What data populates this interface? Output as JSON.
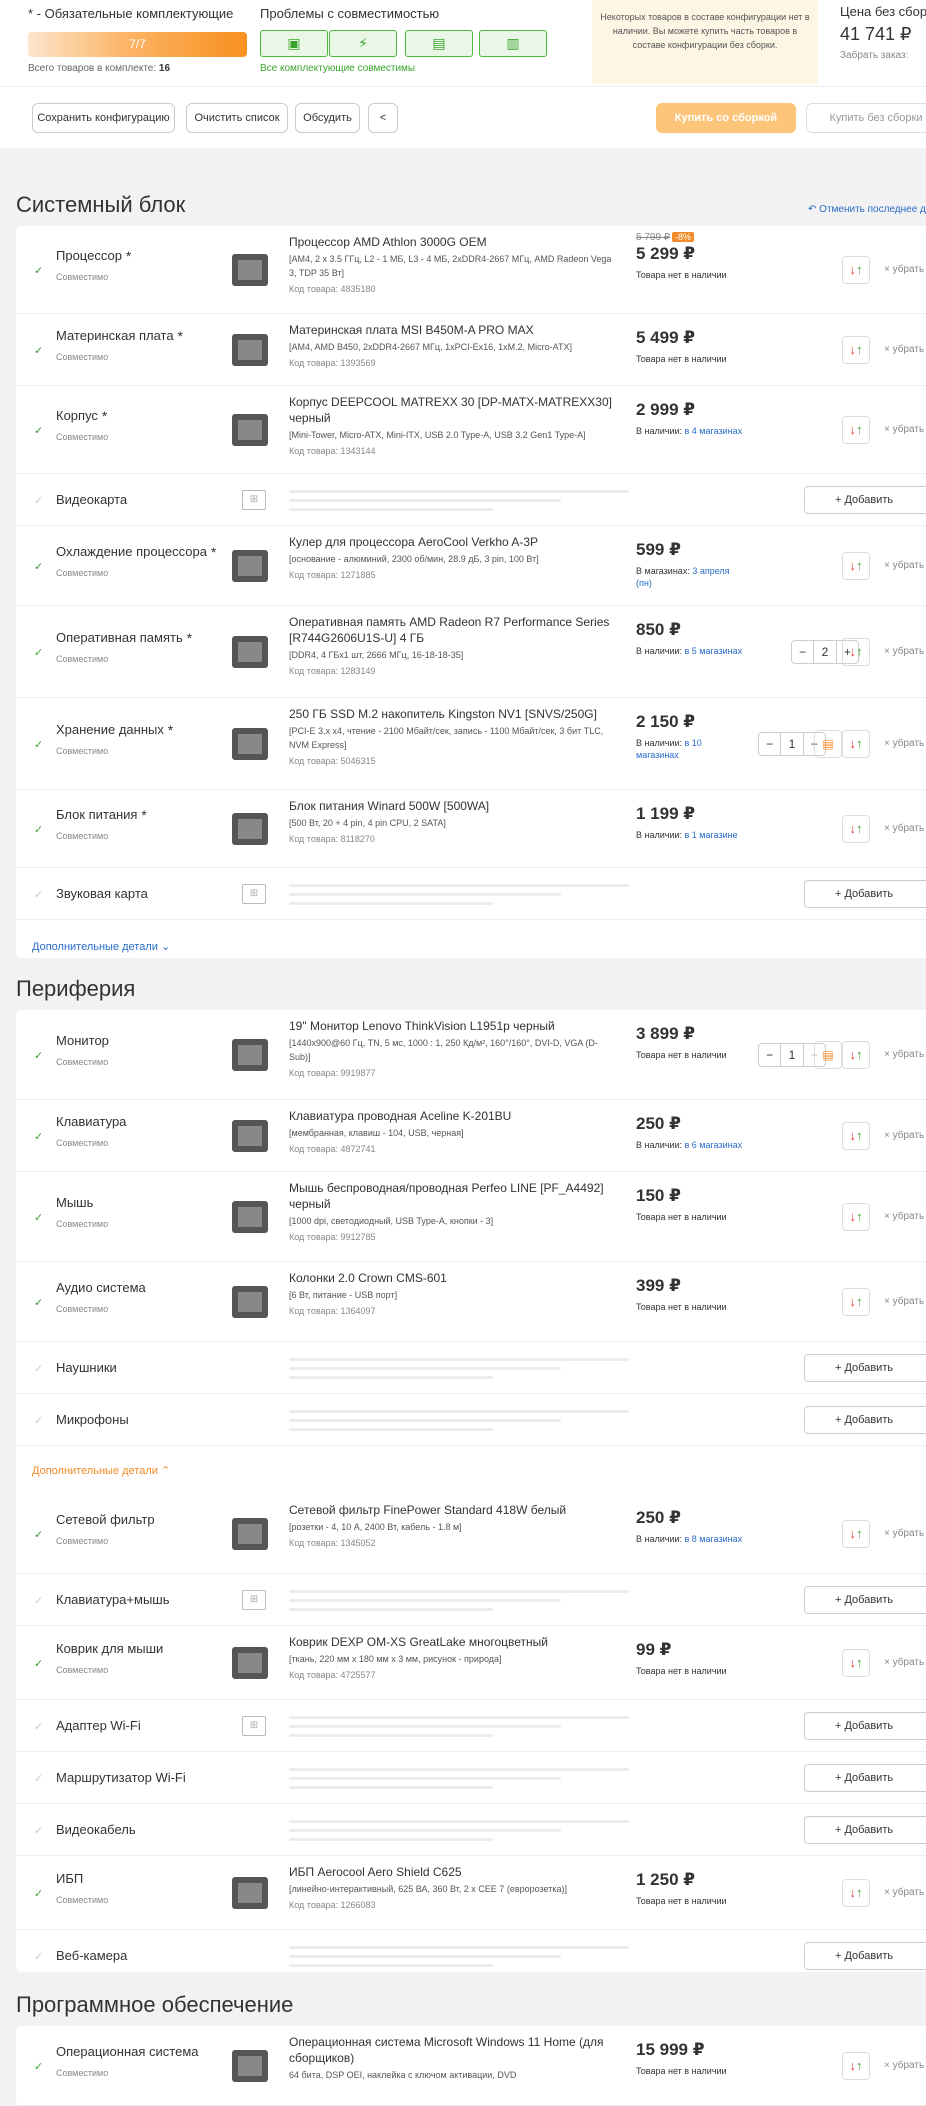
{
  "header": {
    "required_label": "* - Обязательные комплектующие",
    "progress_text": "7/7",
    "progress": 1.0,
    "total_label": "Всего товаров в комплекте:",
    "total_value": "16",
    "compat_title": "Проблемы с совместимостью",
    "compat_ok": "Все комплектующие совместимы",
    "notice": "Некоторых товаров в составе конфигурации нет в наличии. Вы можете купить часть товаров в составе конфигурации без сборки.",
    "price_no_build_label": "Цена без сборки",
    "price_no_build": "41 741 ₽",
    "pickup": "Забрать заказ:"
  },
  "actions": {
    "save": "Сохранить конфигурацию",
    "clear": "Очистить список",
    "discuss": "Обсудить",
    "share_icon": "share-icon",
    "buy_with_build": "Купить со сборкой",
    "buy_without_build": "Купить без сборки"
  },
  "sections": {
    "system_title": "Системный блок",
    "cancel_last": "Отменить последнее действие",
    "peripherals_title": "Периферия",
    "software_title": "Программное обеспечение"
  },
  "common": {
    "compatible": "Совместимо",
    "remove": "убрать",
    "add": "+ Добавить",
    "more_details": "Дополнительные детали",
    "code_prefix": "Код товара:"
  },
  "system_rows": [
    {
      "category": "Процессор",
      "required": true,
      "title": "Процессор AMD Athlon 3000G OEM",
      "spec": "[AM4, 2 x 3.5 ГГц, L2 - 1 МБ, L3 - 4 МБ, 2xDDR4-2667 МГц, AMD Radeon Vega 3, TDP 35 Вт]",
      "code": "Код товара: 4835180",
      "old_price": "5 799 ₽",
      "discount": "-8%",
      "price": "5 299 ₽",
      "stock": "Товара нет в наличии",
      "stock_link": ""
    },
    {
      "category": "Материнская плата",
      "required": true,
      "title": "Материнская плата MSI B450M-A PRO MAX",
      "spec": "[AM4, AMD B450, 2xDDR4-2667 МГц, 1xPCI-Ex16, 1xM.2, Micro-ATX]",
      "code": "Код товара: 1393569",
      "price": "5 499 ₽",
      "stock": "Товара нет в наличии",
      "stock_link": ""
    },
    {
      "category": "Корпус",
      "required": true,
      "title": "Корпус DEEPCOOL MATREXX 30 [DP-MATX-MATREXX30] черный",
      "spec": "[Mini-Tower, Micro-ATX, Mini-ITX, USB 2.0 Type-A, USB 3.2 Gen1 Type-A]",
      "code": "Код товара: 1343144",
      "price": "2 999 ₽",
      "stock": "В наличии:",
      "stock_link": "в 4 магазинах"
    },
    {
      "category": "Видеокарта",
      "empty": true
    },
    {
      "category": "Охлаждение процессора",
      "required": true,
      "title": "Кулер для процессора AeroCool Verkho A-3P",
      "spec": "[основание - алюминий, 2300 об/мин, 28.9 дБ, 3 pin, 100 Вт]",
      "code": "Код товара: 1271885",
      "price": "599 ₽",
      "stock": "В магазинах:",
      "stock_link": "3 апреля (пн)"
    },
    {
      "category": "Оперативная память",
      "required": true,
      "title": "Оперативная память AMD Radeon R7 Performance Series [R744G2606U1S-U] 4 ГБ",
      "spec": "[DDR4, 4 ГБx1 шт, 2666 МГц, 16-18-18-35]",
      "code": "Код товара: 1283149",
      "price": "850 ₽",
      "stock": "В наличии:",
      "stock_link": "в 5 магазинах",
      "qty": "2"
    },
    {
      "category": "Хранение данных",
      "required": true,
      "title": "250 ГБ SSD M.2 накопитель Kingston NV1 [SNVS/250G]",
      "spec": "[PCI-E 3.x x4, чтение - 2100 Мбайт/сек, запись - 1100 Мбайт/сек, 3 бит TLC, NVM Express]",
      "code": "Код товара: 5046315",
      "price": "2 150 ₽",
      "stock": "В наличии:",
      "stock_link": "в 10 магазинах",
      "qty": "1"
    },
    {
      "category": "Блок питания",
      "required": true,
      "title": "Блок питания Winard 500W [500WA]",
      "spec": "[500 Вт, 20 + 4 pin, 4 pin CPU, 2 SATA]",
      "code": "Код товара: 8118270",
      "price": "1 199 ₽",
      "stock": "В наличии:",
      "stock_link": "в 1 магазине"
    },
    {
      "category": "Звуковая карта",
      "empty": true
    }
  ],
  "peripheral_rows": [
    {
      "category": "Монитор",
      "title": "19\" Монитор Lenovo ThinkVision L1951p черный",
      "spec": "[1440x900@60 Гц, TN, 5 мс, 1000 : 1, 250 Кд/м², 160°/160°, DVI-D, VGA (D-Sub)]",
      "code": "Код товара: 9919877",
      "price": "3 899 ₽",
      "stock": "Товара нет в наличии",
      "stock_link": "",
      "qty": "1"
    },
    {
      "category": "Клавиатура",
      "title": "Клавиатура проводная Aceline K-201BU",
      "spec": "[мембранная, клавиш - 104, USB, черная]",
      "code": "Код товара: 4872741",
      "price": "250 ₽",
      "stock": "В наличии:",
      "stock_link": "в 6 магазинах"
    },
    {
      "category": "Мышь",
      "title": "Мышь беспроводная/проводная Perfeo LINE [PF_A4492] черный",
      "spec": "[1000 dpi, светодиодный, USB Type-A, кнопки - 3]",
      "code": "Код товара: 9912785",
      "price": "150 ₽",
      "stock": "Товара нет в наличии",
      "stock_link": ""
    },
    {
      "category": "Аудио система",
      "title": "Колонки 2.0 Crown CMS-601",
      "spec": "[6 Вт, питание - USB порт]",
      "code": "Код товара: 1364097",
      "price": "399 ₽",
      "stock": "Товара нет в наличии",
      "stock_link": ""
    },
    {
      "category": "Наушники",
      "empty": true
    },
    {
      "category": "Микрофоны",
      "empty": true
    }
  ],
  "extra_rows": [
    {
      "category": "Сетевой фильтр",
      "title": "Сетевой фильтр FinePower Standard 418W белый",
      "spec": "[розетки - 4, 10 А, 2400 Вт, кабель - 1.8 м]",
      "code": "Код товара: 1345052",
      "price": "250 ₽",
      "stock": "В наличии:",
      "stock_link": "в 8 магазинах"
    },
    {
      "category": "Клавиатура+мышь",
      "empty": true
    },
    {
      "category": "Коврик для мыши",
      "title": "Коврик DEXP OM-XS GreatLake многоцветный",
      "spec": "[ткань, 220 мм x 180 мм x 3 мм, рисунок - природа]",
      "code": "Код товара: 4725577",
      "price": "99 ₽",
      "stock": "Товара нет в наличии",
      "stock_link": ""
    },
    {
      "category": "Адаптер Wi-Fi",
      "empty": true
    },
    {
      "category": "Маршрутизатор Wi-Fi",
      "empty": true
    },
    {
      "category": "Видеокабель",
      "empty": true
    },
    {
      "category": "ИБП",
      "title": "ИБП Aerocool Aero Shield C625",
      "spec": "[линейно-интерактивный, 625 ВА, 360 Вт, 2 x CEE 7 (евророзетка)]",
      "code": "Код товара: 1266083",
      "price": "1 250 ₽",
      "stock": "Товара нет в наличии",
      "stock_link": ""
    },
    {
      "category": "Веб-камера",
      "empty": true
    }
  ],
  "software_rows": [
    {
      "category": "Операционная система",
      "title": "Операционная система Microsoft Windows 11 Home (для сборщиков)",
      "spec": "64 бита, DSP OEI, наклейка с ключом активации, DVD",
      "price": "15 999 ₽",
      "stock": "Товара нет в наличии",
      "stock_link": ""
    }
  ],
  "colors": {
    "accent": "#f28c28",
    "success": "#3aa52c",
    "link": "#2a6cc8"
  }
}
